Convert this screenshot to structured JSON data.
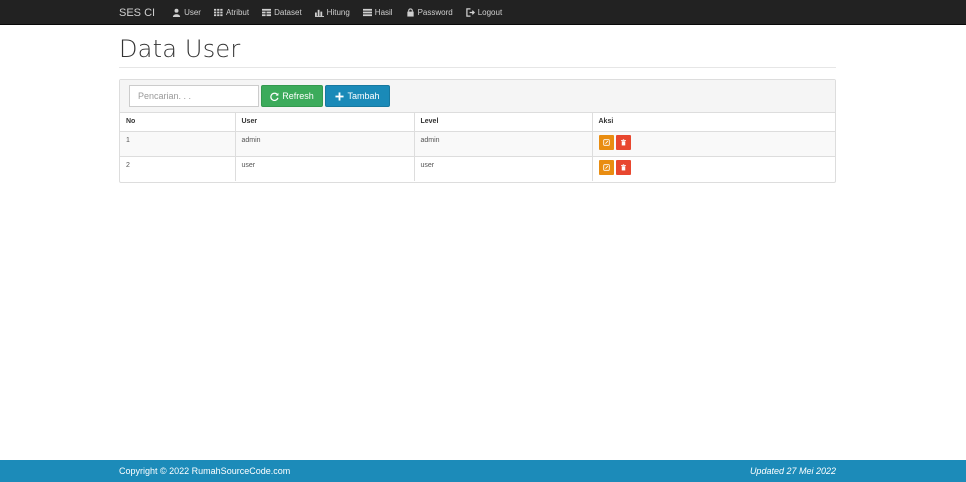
{
  "navbar": {
    "brand": "SES CI",
    "items": [
      {
        "label": "User",
        "icon": "user-icon"
      },
      {
        "label": "Atribut",
        "icon": "grid-icon"
      },
      {
        "label": "Dataset",
        "icon": "table-icon"
      },
      {
        "label": "Hitung",
        "icon": "bar-chart-icon"
      },
      {
        "label": "Hasil",
        "icon": "list-icon"
      },
      {
        "label": "Password",
        "icon": "lock-icon"
      },
      {
        "label": "Logout",
        "icon": "logout-icon"
      }
    ]
  },
  "page": {
    "title": "Data User"
  },
  "toolbar": {
    "search_placeholder": "Pencarian. . .",
    "refresh_label": "Refresh",
    "add_label": "Tambah"
  },
  "table": {
    "headers": [
      "No",
      "User",
      "Level",
      "Aksi"
    ],
    "rows": [
      {
        "no": "1",
        "user": "admin",
        "level": "admin"
      },
      {
        "no": "2",
        "user": "user",
        "level": "user"
      }
    ]
  },
  "footer": {
    "copyright": "Copyright © 2022 RumahSourceCode.com",
    "updated": "Updated 27 Mei 2022"
  },
  "colors": {
    "navbar": "#222222",
    "refresh": "#3cab5b",
    "add": "#1a8ab8",
    "edit": "#e98d11",
    "delete": "#e8472f",
    "footer": "#1c8bb9"
  }
}
